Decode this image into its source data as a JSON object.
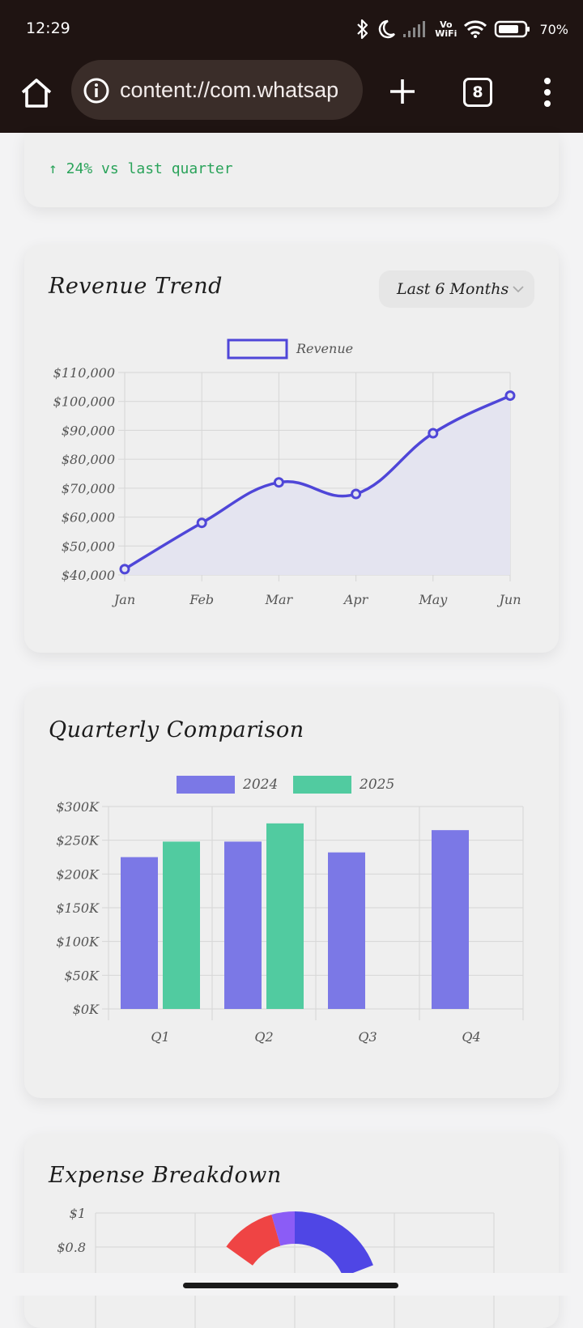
{
  "status_bar": {
    "time": "12:29",
    "vowifi_top": "Vo",
    "vowifi_bottom": "WiFi",
    "battery": "70%",
    "icons": [
      "bluetooth-icon",
      "moon-icon",
      "signal-icon",
      "vowifi-icon",
      "wifi-icon",
      "battery-icon"
    ]
  },
  "browser": {
    "url": "content://com.whatsap",
    "tab_count": "8",
    "icons": [
      "home-icon",
      "info-icon",
      "plus-icon",
      "tabs-icon",
      "menu-icon"
    ]
  },
  "kpi": {
    "change_text": "↑ 24% vs last quarter",
    "color": "#2aa35a"
  },
  "revenue": {
    "title": "Revenue Trend",
    "period_selected": "Last 6 Months"
  },
  "quarterly": {
    "title": "Quarterly Comparison"
  },
  "expense": {
    "title": "Expense Breakdown"
  },
  "chart_data": [
    {
      "id": "revenue_trend",
      "type": "line",
      "title": "Revenue Trend",
      "categories": [
        "Jan",
        "Feb",
        "Mar",
        "Apr",
        "May",
        "Jun"
      ],
      "series": [
        {
          "name": "Revenue",
          "values": [
            42000,
            58000,
            72000,
            68000,
            89000,
            102000
          ],
          "color": "#4f46d8",
          "fill": "#e4e4f0"
        }
      ],
      "ylim": [
        40000,
        110000
      ],
      "yticks": [
        40000,
        50000,
        60000,
        70000,
        80000,
        90000,
        100000,
        110000
      ],
      "ytick_labels": [
        "$40,000",
        "$50,000",
        "$60,000",
        "$70,000",
        "$80,000",
        "$90,000",
        "$100,000",
        "$110,000"
      ],
      "grid": true,
      "legend": "top-center"
    },
    {
      "id": "quarterly_comparison",
      "type": "bar",
      "title": "Quarterly Comparison",
      "categories": [
        "Q1",
        "Q2",
        "Q3",
        "Q4"
      ],
      "series": [
        {
          "name": "2024",
          "values": [
            225000,
            248000,
            232000,
            265000
          ],
          "color": "#7b78e6"
        },
        {
          "name": "2025",
          "values": [
            248000,
            275000,
            null,
            null
          ],
          "color": "#51cba0"
        }
      ],
      "ylim": [
        0,
        300000
      ],
      "yticks": [
        0,
        50000,
        100000,
        150000,
        200000,
        250000,
        300000
      ],
      "ytick_labels": [
        "$0K",
        "$50K",
        "$100K",
        "$150K",
        "$200K",
        "$250K",
        "$300K"
      ],
      "grid": true,
      "legend": "top-center"
    },
    {
      "id": "expense_breakdown",
      "type": "pie",
      "title": "Expense Breakdown",
      "ytick_labels": [
        "$1",
        "$0.8"
      ],
      "slice_colors": [
        "#4f46e5",
        "#ef4444",
        "#8b5cf6"
      ]
    }
  ]
}
